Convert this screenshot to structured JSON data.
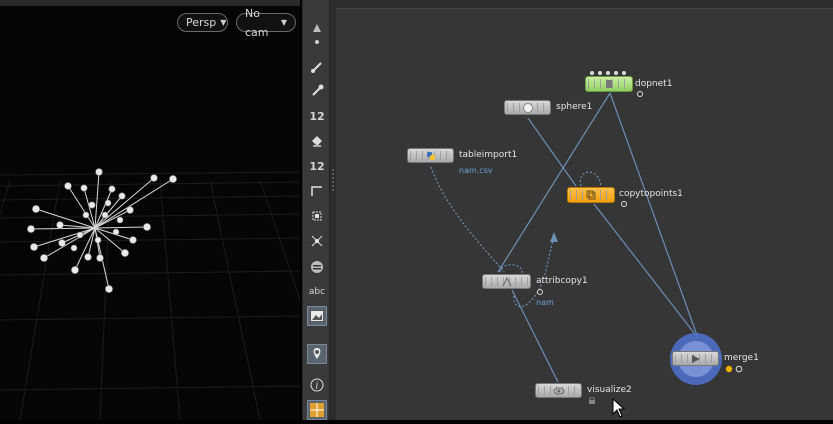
{
  "viewport": {
    "persp_label": "Persp",
    "cam_label": "No cam"
  },
  "toolbar": {
    "icons": [
      "arrow-up-icon",
      "dot-icon",
      "brush-icon",
      "pin-tool-icon",
      "number-12-icon",
      "paint-bucket-icon",
      "number-12-icon",
      "curve-icon",
      "transform-icon",
      "axis-icon",
      "list-icon",
      "text-icon",
      "image-icon",
      "geo-pin-icon",
      "info-icon",
      "grid-icon"
    ],
    "numeric_label_1": "12",
    "numeric_label_2": "12",
    "text_label": "abc",
    "info_label": "i"
  },
  "network": {
    "nodes": {
      "dopnet": {
        "label": "dopnet1"
      },
      "sphere": {
        "label": "sphere1"
      },
      "tableimport": {
        "label": "tableimport1",
        "sub": "nam.csv"
      },
      "copytopoints": {
        "label": "copytopoints1"
      },
      "attribcopy": {
        "label": "attribcopy1",
        "sub": "nam"
      },
      "merge": {
        "label": "merge1"
      },
      "visualize": {
        "label": "visualize2"
      }
    },
    "colors": {
      "background": "#363636",
      "wire": "#6e8fb8",
      "dopnet_fill": "#a6e07a",
      "copytopoints_fill": "#f5a623",
      "merge_ring": "#4f6fc8"
    }
  }
}
